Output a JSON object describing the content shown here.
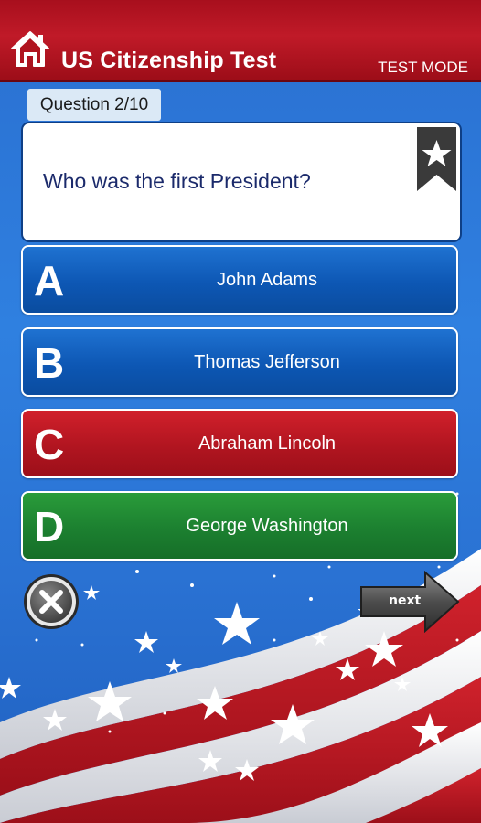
{
  "header": {
    "title": "US Citizenship Test",
    "mode": "TEST MODE"
  },
  "question": {
    "counter": "Question 2/10",
    "text": "Who was the first President?"
  },
  "answers": [
    {
      "letter": "A",
      "text": "John Adams",
      "color": "#0d57b4"
    },
    {
      "letter": "B",
      "text": "Thomas Jefferson",
      "color": "#0d57b4"
    },
    {
      "letter": "C",
      "text": "Abraham Lincoln",
      "color": "#b11520"
    },
    {
      "letter": "D",
      "text": "George Washington",
      "color": "#1c8030"
    }
  ],
  "controls": {
    "next_label": "next"
  },
  "colors": {
    "header_red": "#b0141f",
    "background_blue": "#2f80e0",
    "question_text": "#1b2a6b"
  },
  "icons": {
    "home": "home-icon",
    "bookmark": "bookmark-star-icon",
    "close": "close-icon",
    "next": "next-arrow-icon"
  }
}
